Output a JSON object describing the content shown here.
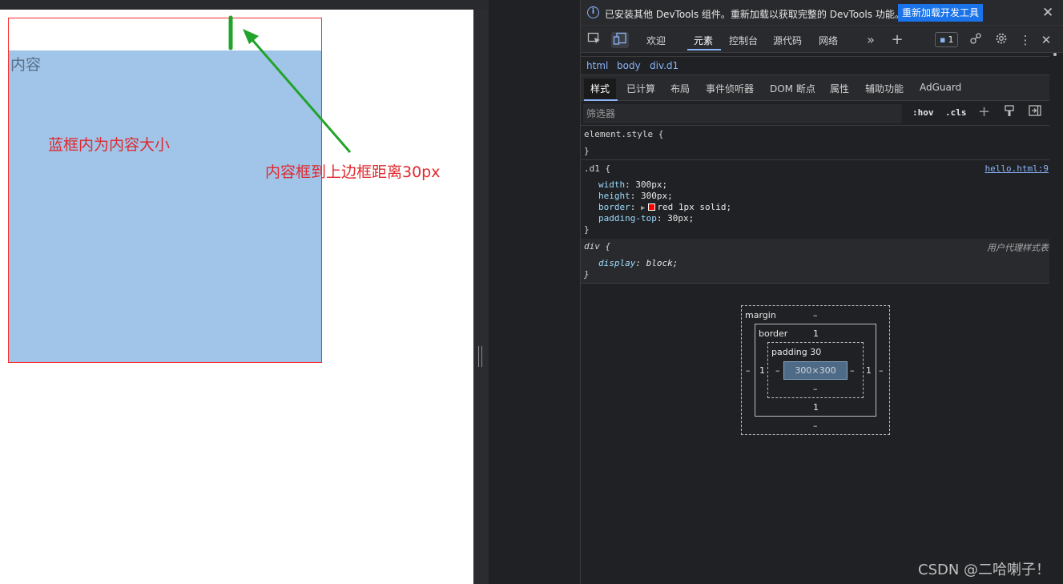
{
  "page": {
    "content_label": "内容",
    "note_blue_box": "蓝框内为内容大小",
    "note_distance": "内容框到上边框距离30px"
  },
  "infobar": {
    "icon": "info-icon",
    "message": "已安装其他 DevTools 组件。重新加载以获取完整的 DevTools 功能。",
    "reload_button": "重新加载开发工具",
    "close_icon": "close-icon"
  },
  "tabs": [
    "欢迎",
    "元素",
    "控制台",
    "源代码",
    "网络"
  ],
  "toolbar": {
    "issues_count": "1",
    "more_tabs_icon": "double-chevron-icon",
    "add_tab_icon": "plus-icon"
  },
  "breadcrumb": [
    "html",
    "body",
    "div.d1"
  ],
  "subtabs": [
    "样式",
    "已计算",
    "布局",
    "事件侦听器",
    "DOM 断点",
    "属性",
    "辅助功能",
    "AdGuard"
  ],
  "filter": {
    "placeholder": "筛选器",
    "hov": ":hov",
    "cls": ".cls"
  },
  "styles": {
    "element_style_open": "element.style {",
    "close_brace": "}",
    "d1_selector": ".d1 {",
    "d1_source": "hello.html:9",
    "d1_props": [
      {
        "name": "width",
        "value": "300px;"
      },
      {
        "name": "height",
        "value": "300px;"
      },
      {
        "name": "border",
        "value": "red 1px solid;"
      },
      {
        "name": "padding-top",
        "value": "30px;"
      }
    ],
    "ua_selector": "div {",
    "ua_source": "用户代理样式表",
    "ua_prop": {
      "name": "display",
      "value": "block;"
    }
  },
  "box_model": {
    "margin_label": "margin",
    "margin_top": "–",
    "margin_left": "–",
    "margin_right": "–",
    "margin_bottom": "–",
    "border_label": "border",
    "border_top": "1",
    "border_left": "1",
    "border_right": "1",
    "border_bottom": "1",
    "padding_label": "padding 30",
    "padding_left": "–",
    "padding_right": "–",
    "padding_bottom": "–",
    "content_size": "300×300"
  },
  "watermark": "CSDN @二哈喇子！",
  "colors": {
    "d1_border": "#ff2a2a",
    "content_fill": "#a0c5e8",
    "annotation_red": "#e0282e",
    "arrow_green": "#22a32a",
    "devtools_bg": "#202124",
    "link_blue": "#8ab4f8"
  }
}
